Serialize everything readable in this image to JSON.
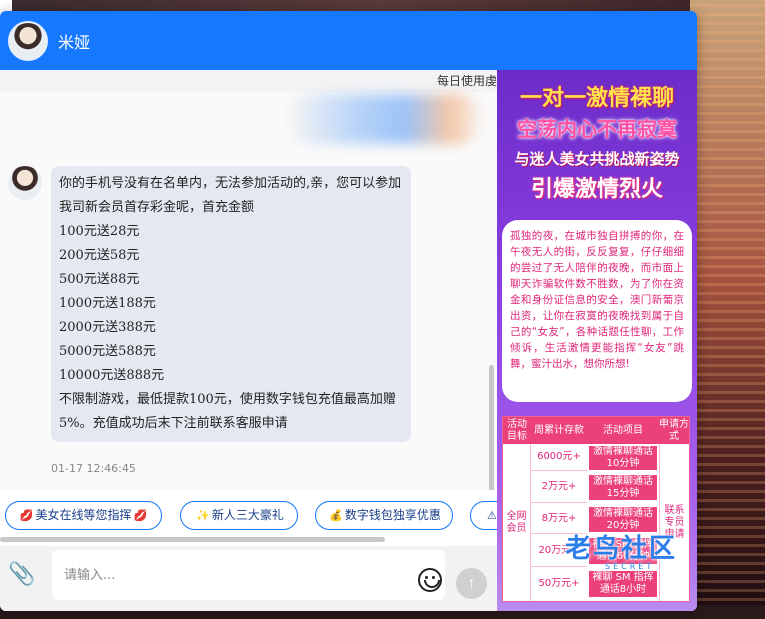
{
  "header": {
    "title": "米娅"
  },
  "notice": {
    "text": "每日使用虔"
  },
  "message": {
    "lines": [
      "你的手机号没有在名单内，无法参加活动的,亲，您可以参加我司新会员首存彩金呢，首充金额",
      "100元送28元",
      "200元送58元",
      "500元送88元",
      "1000元送188元",
      "2000元送388元",
      "5000元送588元",
      "10000元送888元",
      "不限制游戏，最低提款100元，使用数字钱包充值最高加赠5%。充值成功后末下注前联系客服申请"
    ],
    "time": "01-17 12:46:45"
  },
  "quick_replies": [
    {
      "icon": "lips-icon",
      "label": "美女在线等您指挥"
    },
    {
      "icon": "sparkle-icon",
      "label": "新人三大豪礼"
    },
    {
      "icon": "money-bag-icon",
      "label": "数字钱包独享优惠"
    }
  ],
  "input": {
    "placeholder": "请输入..."
  },
  "ad": {
    "line1": "一对一激情裸聊",
    "line2": "空荡内心不再寂寞",
    "line3": "与迷人美女共挑战新姿势",
    "line4": "引爆激情烈火",
    "story": "孤独的夜，在城市独自拼搏的你，在午夜无人的街，反反复复，仔仔细细的尝过了无人陪伴的夜晚，而市面上聊天诈骗软件数不胜数，为了你在资金和身份证信息的安全，澳门新葡京出资，让你在寂寞的夜晚找到属于自己的“女友”，各种话题任性聊，工作倾诉，生活激情更能指挥“女友”跳舞，蜜汁出水，想你所想!",
    "table": {
      "headers": [
        "活动目标",
        "周累计存款",
        "活动项目",
        "申请方式"
      ],
      "target": "全网会员",
      "method": "联系专员申请",
      "rows": [
        {
          "amount": "6000元+",
          "item": "激情裸聊通话10分钟"
        },
        {
          "amount": "2万元+",
          "item": "激情裸聊通话15分钟"
        },
        {
          "amount": "8万元+",
          "item": "激情裸聊通话20分钟"
        },
        {
          "amount": "20万元+",
          "item": "裸聊 SM 指挥通话60分钟"
        },
        {
          "amount": "50万元+",
          "item": "裸聊 SM 指挥通话8小时"
        }
      ]
    }
  },
  "watermark": {
    "text": "老鸟社区",
    "sub": "SECRET"
  }
}
